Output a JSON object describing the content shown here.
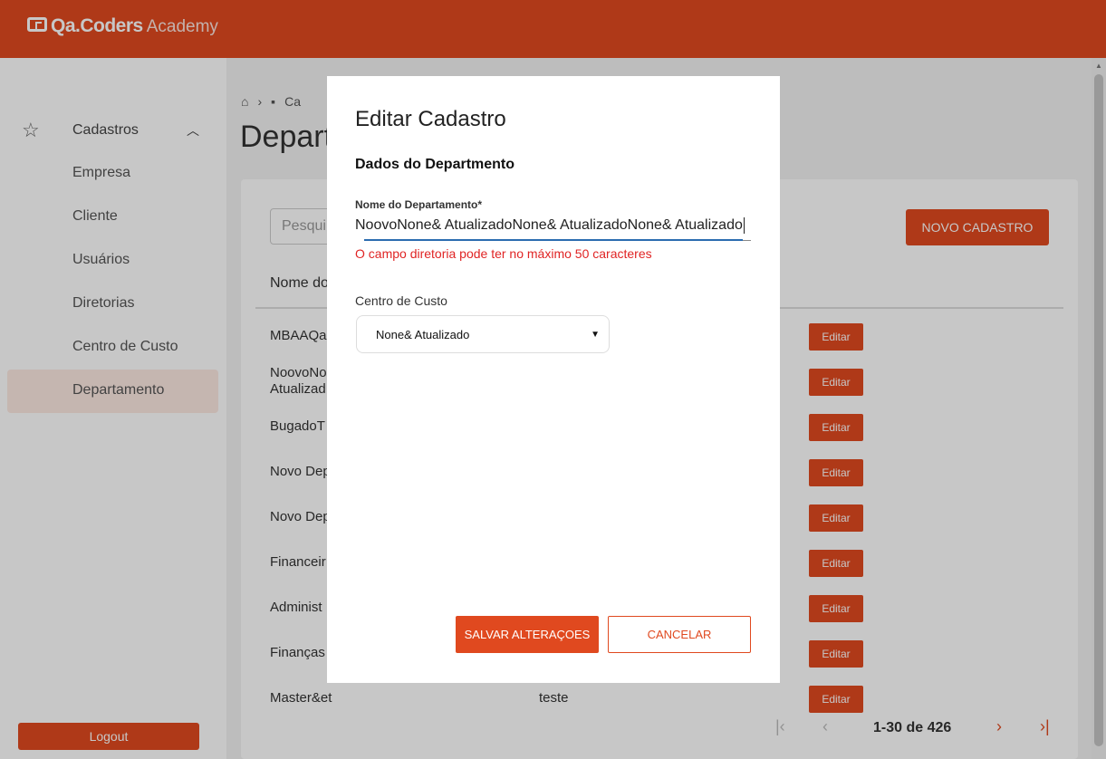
{
  "app": {
    "logo_main": "Qa.Coders",
    "logo_sub": "Academy"
  },
  "sidebar": {
    "group_label": "Cadastros",
    "items": [
      {
        "label": "Empresa"
      },
      {
        "label": "Cliente"
      },
      {
        "label": "Usuários"
      },
      {
        "label": "Diretorias"
      },
      {
        "label": "Centro de Custo"
      },
      {
        "label": "Departamento"
      }
    ],
    "logout_label": "Logout"
  },
  "main": {
    "breadcrumb": [
      "Ca"
    ],
    "page_title": "Depart",
    "search_placeholder": "Pesqui",
    "new_button_label": "NOVO CADASTRO",
    "column_name": "Nome do",
    "rows": [
      {
        "name": "MBAAQa",
        "desc": ""
      },
      {
        "name": "NoovoNo Atualizad",
        "desc": ""
      },
      {
        "name": "BugadoT",
        "desc": ""
      },
      {
        "name": "Novo Dep",
        "desc": ""
      },
      {
        "name": "Novo Dep",
        "desc": ""
      },
      {
        "name": "Financeir",
        "desc": ""
      },
      {
        "name": "Administ",
        "desc": ""
      },
      {
        "name": "Finanças",
        "desc": ""
      },
      {
        "name": "Master&et",
        "desc": "teste"
      }
    ],
    "edit_label": "Editar",
    "pagination_text": "1-30 de 426"
  },
  "modal": {
    "title": "Editar Cadastro",
    "subtitle": "Dados do Departmento",
    "name_field_label": "Nome do Departamento*",
    "name_field_value": "NoovoNone& AtualizadoNone& AtualizadoNone& Atualizado",
    "name_field_error": "O campo diretoria pode ter no máximo 50 caracteres",
    "cost_center_label": "Centro de Custo",
    "cost_center_selected": "None& Atualizado",
    "save_label": "SALVAR ALTERAÇOES",
    "cancel_label": "CANCELAR"
  },
  "colors": {
    "accent": "#e0491f",
    "error": "#e02424",
    "focus_underline": "#2b6cb0"
  }
}
